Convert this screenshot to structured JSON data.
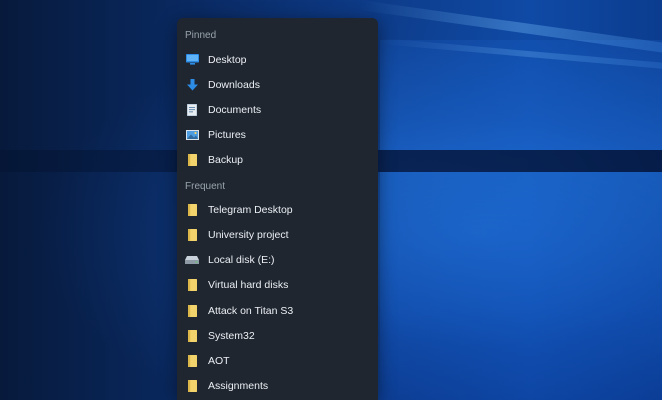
{
  "jumplist": {
    "pinned_header": "Pinned",
    "frequent_header": "Frequent",
    "pinned": [
      {
        "label": "Desktop",
        "icon": "desktop-icon"
      },
      {
        "label": "Downloads",
        "icon": "downloads-icon"
      },
      {
        "label": "Documents",
        "icon": "documents-icon"
      },
      {
        "label": "Pictures",
        "icon": "pictures-icon"
      },
      {
        "label": "Backup",
        "icon": "folder-icon"
      }
    ],
    "frequent": [
      {
        "label": "Telegram Desktop",
        "icon": "folder-icon"
      },
      {
        "label": "University project",
        "icon": "folder-icon"
      },
      {
        "label": "Local disk (E:)",
        "icon": "drive-icon"
      },
      {
        "label": "Virtual hard disks",
        "icon": "folder-icon"
      },
      {
        "label": "Attack on Titan S3",
        "icon": "folder-icon"
      },
      {
        "label": "System32",
        "icon": "folder-icon"
      },
      {
        "label": "AOT",
        "icon": "folder-icon"
      },
      {
        "label": "Assignments",
        "icon": "folder-icon"
      }
    ]
  },
  "colors": {
    "menu_bg": "#1f2630",
    "header_text": "#9aa3ad",
    "item_text": "#ecf0f4",
    "folder_yellow": "#f3d36b",
    "accent_blue": "#2d8ce6"
  }
}
